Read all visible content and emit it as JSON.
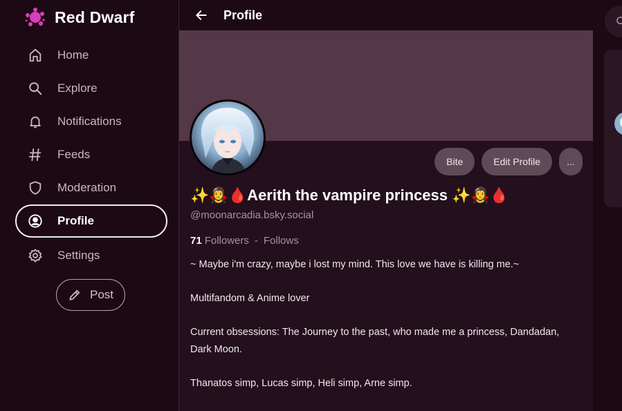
{
  "brand": {
    "name": "Red Dwarf",
    "logo_icon": "splat-logo-icon",
    "logo_color": "#d83fb9"
  },
  "sidebar": {
    "items": [
      {
        "label": "Home",
        "icon": "home-icon"
      },
      {
        "label": "Explore",
        "icon": "search-icon"
      },
      {
        "label": "Notifications",
        "icon": "bell-icon"
      },
      {
        "label": "Feeds",
        "icon": "hash-icon"
      },
      {
        "label": "Moderation",
        "icon": "shield-icon"
      },
      {
        "label": "Profile",
        "icon": "user-circle-icon",
        "active": true
      },
      {
        "label": "Settings",
        "icon": "gear-icon"
      }
    ],
    "post_label": "Post"
  },
  "header": {
    "title": "Profile",
    "back_icon": "arrow-left-icon"
  },
  "profile": {
    "display_name": "✨🧛‍♀️🩸Aerith the vampire princess ✨🧛‍♀️🩸",
    "handle": "@moonarcadia.bsky.social",
    "followers_count": "71",
    "followers_label": "Followers",
    "separator": "-",
    "follows_label": "Follows",
    "bio": [
      "~ Maybe i'm crazy, maybe i lost my mind. This love we have is killing me.~",
      "",
      "Multifandom & Anime lover",
      "",
      "Current obsessions:  The Journey to the past, who made me a princess, Dandadan, Dark Moon.",
      "",
      "Thanatos simp, Lucas simp, Heli simp, Arne simp."
    ],
    "actions": {
      "bite_label": "Bite",
      "edit_label": "Edit Profile",
      "more_label": "..."
    }
  },
  "colors": {
    "background": "#1d0914",
    "panel": "#23101c",
    "banner": "#553847",
    "button": "#614a57",
    "muted_text": "#a9919f"
  }
}
